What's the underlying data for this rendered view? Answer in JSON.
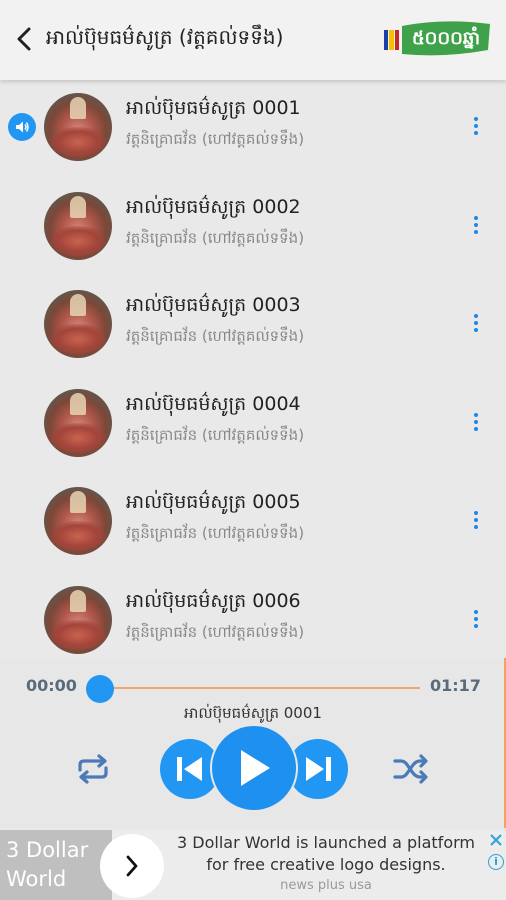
{
  "header": {
    "title": "អាល់ប៊ុមធម៌សូត្រ (វត្តគល់ទទឹង)",
    "logo_text": "៥០០០ឆ្នាំ"
  },
  "songs": [
    {
      "title": "អាល់ប៊ុមធម៌សូត្រ 0001",
      "subtitle": "វត្តនិគ្រោធវ័ន (ហៅវត្តគល់ទទឹង)",
      "playing": true
    },
    {
      "title": "អាល់ប៊ុមធម៌សូត្រ 0002",
      "subtitle": "វត្តនិគ្រោធវ័ន (ហៅវត្តគល់ទទឹង)",
      "playing": false
    },
    {
      "title": "អាល់ប៊ុមធម៌សូត្រ 0003",
      "subtitle": "វត្តនិគ្រោធវ័ន (ហៅវត្តគល់ទទឹង)",
      "playing": false
    },
    {
      "title": "អាល់ប៊ុមធម៌សូត្រ 0004",
      "subtitle": "វត្តនិគ្រោធវ័ន (ហៅវត្តគល់ទទឹង)",
      "playing": false
    },
    {
      "title": "អាល់ប៊ុមធម៌សូត្រ 0005",
      "subtitle": "វត្តនិគ្រោធវ័ន (ហៅវត្តគល់ទទឹង)",
      "playing": false
    },
    {
      "title": "អាល់ប៊ុមធម៌សូត្រ 0006",
      "subtitle": "វត្តនិគ្រោធវ័ន (ហៅវត្តគល់ទទឹង)",
      "playing": false
    }
  ],
  "player": {
    "current_time": "00:00",
    "duration": "01:17",
    "progress": 0,
    "now_playing": "អាល់ប៊ុមធម៌សូត្រ 0001"
  },
  "ad": {
    "brand": "3 Dollar World",
    "headline": "3 Dollar World is launched a platform for free creative logo designs.",
    "source": "news plus usa"
  },
  "colors": {
    "accent": "#2196f3",
    "seek_track": "#f5a66e",
    "logo_green": "#3fa24a"
  }
}
